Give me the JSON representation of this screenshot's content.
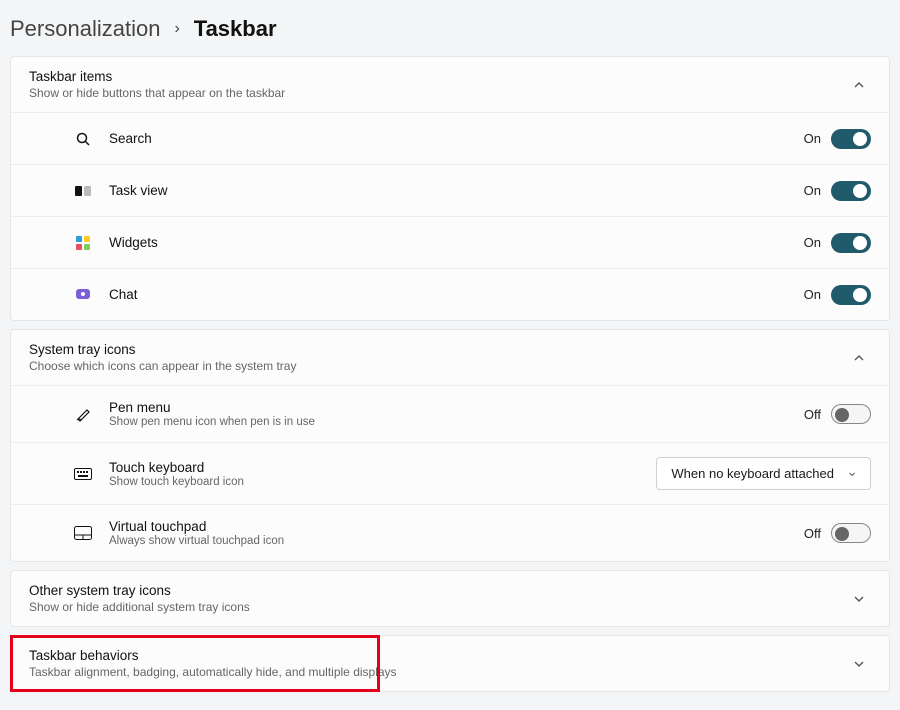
{
  "breadcrumb": {
    "parent": "Personalization",
    "current": "Taskbar"
  },
  "sections": {
    "taskbar_items": {
      "title": "Taskbar items",
      "sub": "Show or hide buttons that appear on the taskbar",
      "chevron": "up",
      "rows": [
        {
          "icon": "search-icon",
          "label": "Search",
          "state": "On",
          "toggle": "on"
        },
        {
          "icon": "taskview-icon",
          "label": "Task view",
          "state": "On",
          "toggle": "on"
        },
        {
          "icon": "widgets-icon",
          "label": "Widgets",
          "state": "On",
          "toggle": "on"
        },
        {
          "icon": "chat-icon",
          "label": "Chat",
          "state": "On",
          "toggle": "on"
        }
      ]
    },
    "system_tray": {
      "title": "System tray icons",
      "sub": "Choose which icons can appear in the system tray",
      "chevron": "up",
      "rows": [
        {
          "icon": "pen-icon",
          "label": "Pen menu",
          "sub": "Show pen menu icon when pen is in use",
          "state": "Off",
          "toggle": "off"
        },
        {
          "icon": "keyboard-icon",
          "label": "Touch keyboard",
          "sub": "Show touch keyboard icon",
          "select": "When no keyboard attached"
        },
        {
          "icon": "touchpad-icon",
          "label": "Virtual touchpad",
          "sub": "Always show virtual touchpad icon",
          "state": "Off",
          "toggle": "off"
        }
      ]
    },
    "other_tray": {
      "title": "Other system tray icons",
      "sub": "Show or hide additional system tray icons",
      "chevron": "down"
    },
    "behaviors": {
      "title": "Taskbar behaviors",
      "sub": "Taskbar alignment, badging, automatically hide, and multiple displays",
      "chevron": "down"
    }
  }
}
